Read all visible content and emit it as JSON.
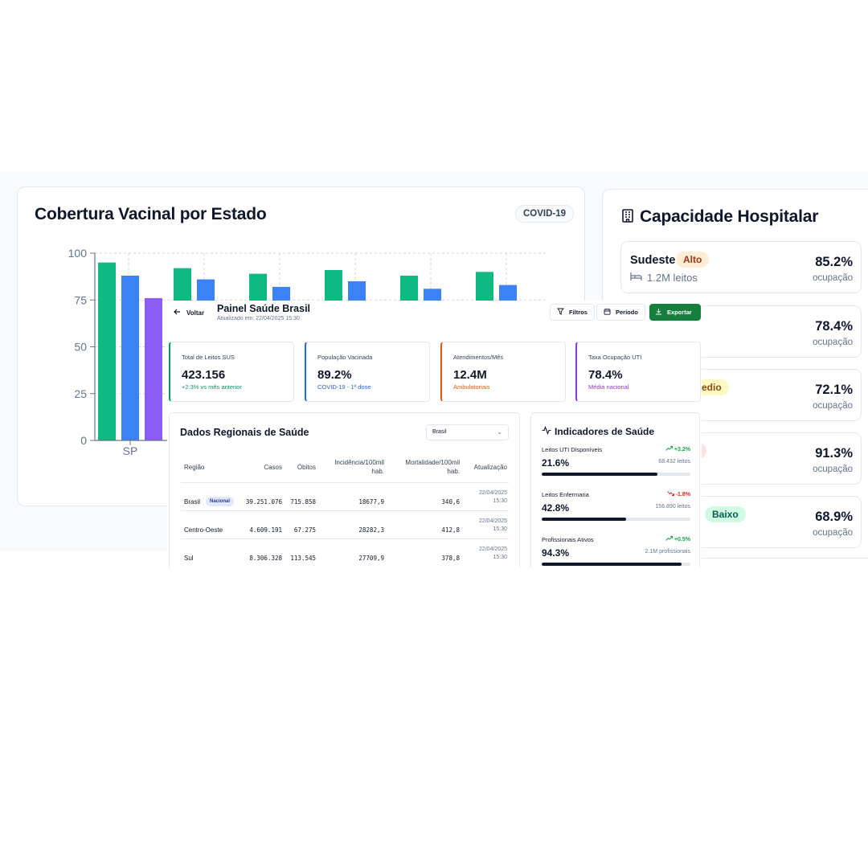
{
  "vaccination": {
    "title": "Cobertura Vacinal por Estado",
    "badge": "COVID-19",
    "chart_data": {
      "type": "bar",
      "categories": [
        "SP"
      ],
      "yticks": [
        "100",
        "75",
        "50",
        "25",
        "0"
      ],
      "ylim": [
        0,
        100
      ],
      "series": [
        {
          "color": "#10b981",
          "values": [
            95,
            92,
            89,
            91,
            88,
            90
          ]
        },
        {
          "color": "#3b82f6",
          "values": [
            88,
            86,
            82,
            85,
            81,
            83
          ]
        },
        {
          "color": "#8b5cf6",
          "values": [
            76
          ]
        }
      ],
      "grid": true
    }
  },
  "hospital": {
    "title": "Capacidade Hospitalar",
    "rows": [
      {
        "region": "Sudeste",
        "level": "Alto",
        "level_bg": "#ffedd5",
        "level_color": "#9a3412",
        "beds": "1.2M leitos",
        "pct": "85.2%",
        "sub": "ocupação"
      },
      {
        "region": "",
        "level": "",
        "beds": "",
        "pct": "78.4%",
        "sub": "ocupação"
      },
      {
        "region": "",
        "level": "edio",
        "level_bg": "#fef9c3",
        "level_color": "#854d0e",
        "beds": "",
        "pct": "72.1%",
        "sub": "ocupação"
      },
      {
        "region": "",
        "level": "",
        "level_bg": "#fee2e2",
        "beds": "",
        "pct": "91.3%",
        "sub": "ocupação"
      },
      {
        "region": "",
        "level": "Baixo",
        "level_bg": "#d1fae5",
        "level_color": "#065f46",
        "beds": "",
        "pct": "68.9%",
        "sub": "ocupação"
      }
    ]
  },
  "panel": {
    "back": "Voltar",
    "title": "Painel Saúde Brasil",
    "updated": "Atualizado em: 22/04/2025 15:30",
    "buttons": {
      "filters": "Filtros",
      "period": "Período",
      "export": "Exportar"
    },
    "stats": [
      {
        "label": "Total de Leitos SUS",
        "value": "423.156",
        "sub": "+2.3% vs mês anterior",
        "color": "#059669"
      },
      {
        "label": "População Vacinada",
        "value": "89.2%",
        "sub": "COVID-19 - 1ª dose",
        "color": "#2563eb"
      },
      {
        "label": "Atendimentos/Mês",
        "value": "12.4M",
        "sub": "Ambulatoriais",
        "color": "#ea580c"
      },
      {
        "label": "Taxa Ocupação UTI",
        "value": "78.4%",
        "sub": "Média nacional",
        "color": "#9333ea"
      }
    ],
    "regional": {
      "title": "Dados Regionais de Saúde",
      "select": "Brasil",
      "headers": {
        "region": "Região",
        "cases": "Casos",
        "deaths": "Óbitos",
        "incidence_1": "Incidência/100mil",
        "incidence_2": "hab.",
        "mortality_1": "Mortalidade/100mil",
        "mortality_2": "hab.",
        "updated": "Atualização"
      },
      "rows": [
        {
          "region": "Brasil",
          "badge": "Nacional",
          "cases": "39.251.076",
          "deaths": "715.858",
          "incidence": "18677,9",
          "mortality": "340,6",
          "date": "22/04/2025",
          "time": "15:30"
        },
        {
          "region": "Centro-Oeste",
          "cases": "4.609.191",
          "deaths": "67.275",
          "incidence": "28282,3",
          "mortality": "412,8",
          "date": "22/04/2025",
          "time": "15:30"
        },
        {
          "region": "Sul",
          "cases": "8.306.328",
          "deaths": "113.545",
          "incidence": "27709,9",
          "mortality": "378,8",
          "date": "22/04/2025",
          "time": "15:30"
        }
      ]
    },
    "indicators": {
      "title": "Indicadores de Saúde",
      "items": [
        {
          "label": "Leitos UTI Disponíveis",
          "trend": "+3.2%",
          "trend_dir": "up",
          "value": "21.6%",
          "detail": "68.432 leitos",
          "progress": 0.78
        },
        {
          "label": "Leitos Enfermaria",
          "trend": "-1.8%",
          "trend_dir": "down",
          "value": "42.8%",
          "detail": "156.890 leitos",
          "progress": 0.57
        },
        {
          "label": "Profissionais Ativos",
          "trend": "+0.5%",
          "trend_dir": "up",
          "value": "94.3%",
          "detail": "2.1M profissionais",
          "progress": 0.94
        }
      ]
    }
  }
}
